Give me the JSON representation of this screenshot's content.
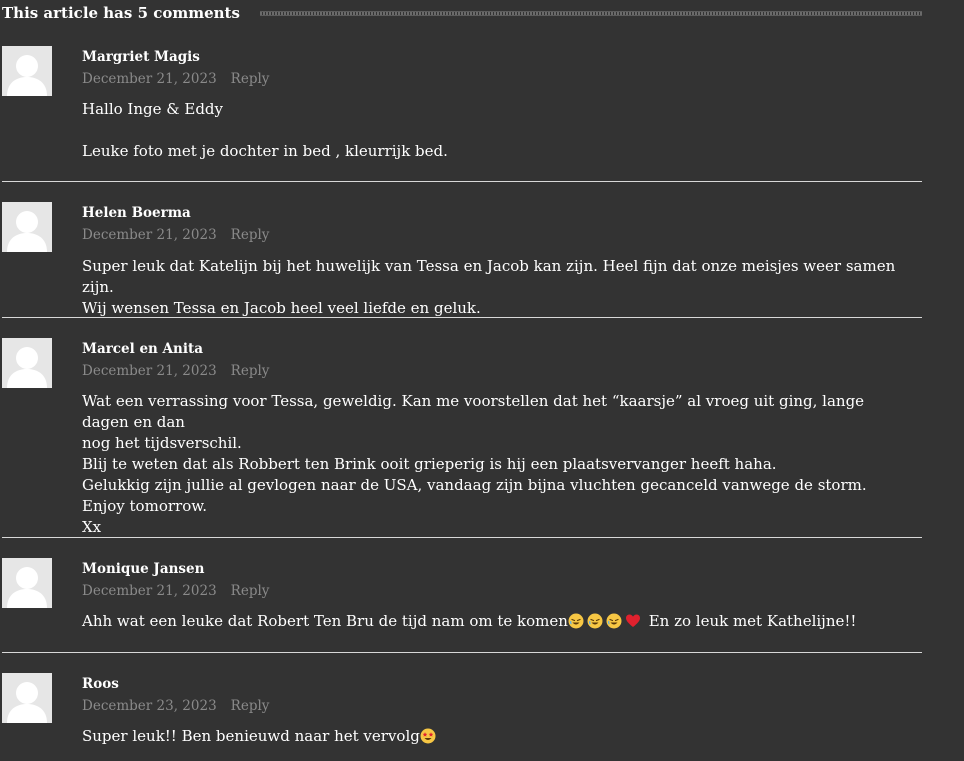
{
  "header": {
    "title": "This article has 5 comments"
  },
  "comments": [
    {
      "author": "Margriet Magis",
      "date": "December 21, 2023",
      "reply_label": "Reply",
      "lines": [
        "Hallo Inge & Eddy",
        "",
        "Leuke foto met je dochter in bed , kleurrijk bed."
      ]
    },
    {
      "author": "Helen Boerma",
      "date": "December 21, 2023",
      "reply_label": "Reply",
      "lines": [
        "Super leuk dat Katelijn bij het huwelijk van Tessa en Jacob kan zijn. Heel fijn dat onze meisjes weer samen zijn.",
        "Wij wensen Tessa en Jacob heel veel liefde en geluk."
      ]
    },
    {
      "author": "Marcel en Anita",
      "date": "December 21, 2023",
      "reply_label": "Reply",
      "lines": [
        "Wat een verrassing voor Tessa, geweldig. Kan me voorstellen dat het “kaarsje” al vroeg uit ging, lange dagen en dan",
        "nog het tijdsverschil.",
        "Blij te weten dat als Robbert ten Brink ooit grieperig is hij een plaatsvervanger heeft haha.",
        "Gelukkig zijn jullie al gevlogen naar de USA, vandaag zijn bijna vluchten gecanceld vanwege de storm.",
        "Enjoy tomorrow.",
        "Xx"
      ]
    },
    {
      "author": "Monique Jansen",
      "date": "December 21, 2023",
      "reply_label": "Reply",
      "text_before": "Ahh wat een leuke dat Robert Ten Bru de tijd nam om te komen",
      "emojis": [
        "rolling-laughing-icon",
        "rolling-laughing-icon",
        "rolling-laughing-icon",
        "red-heart-icon"
      ],
      "text_after": "En zo leuk met Kathelijne!!"
    },
    {
      "author": "Roos",
      "date": "December 23, 2023",
      "reply_label": "Reply",
      "text_before": "Super leuk!! Ben benieuwd naar het vervolg",
      "emojis": [
        "star-struck-icon"
      ],
      "text_after": ""
    }
  ],
  "colors": {
    "background": "#333333",
    "text": "#ffffff",
    "meta": "#8a8a8a",
    "divider": "#d8d8d8",
    "avatar_bg": "#e6e6e6"
  }
}
